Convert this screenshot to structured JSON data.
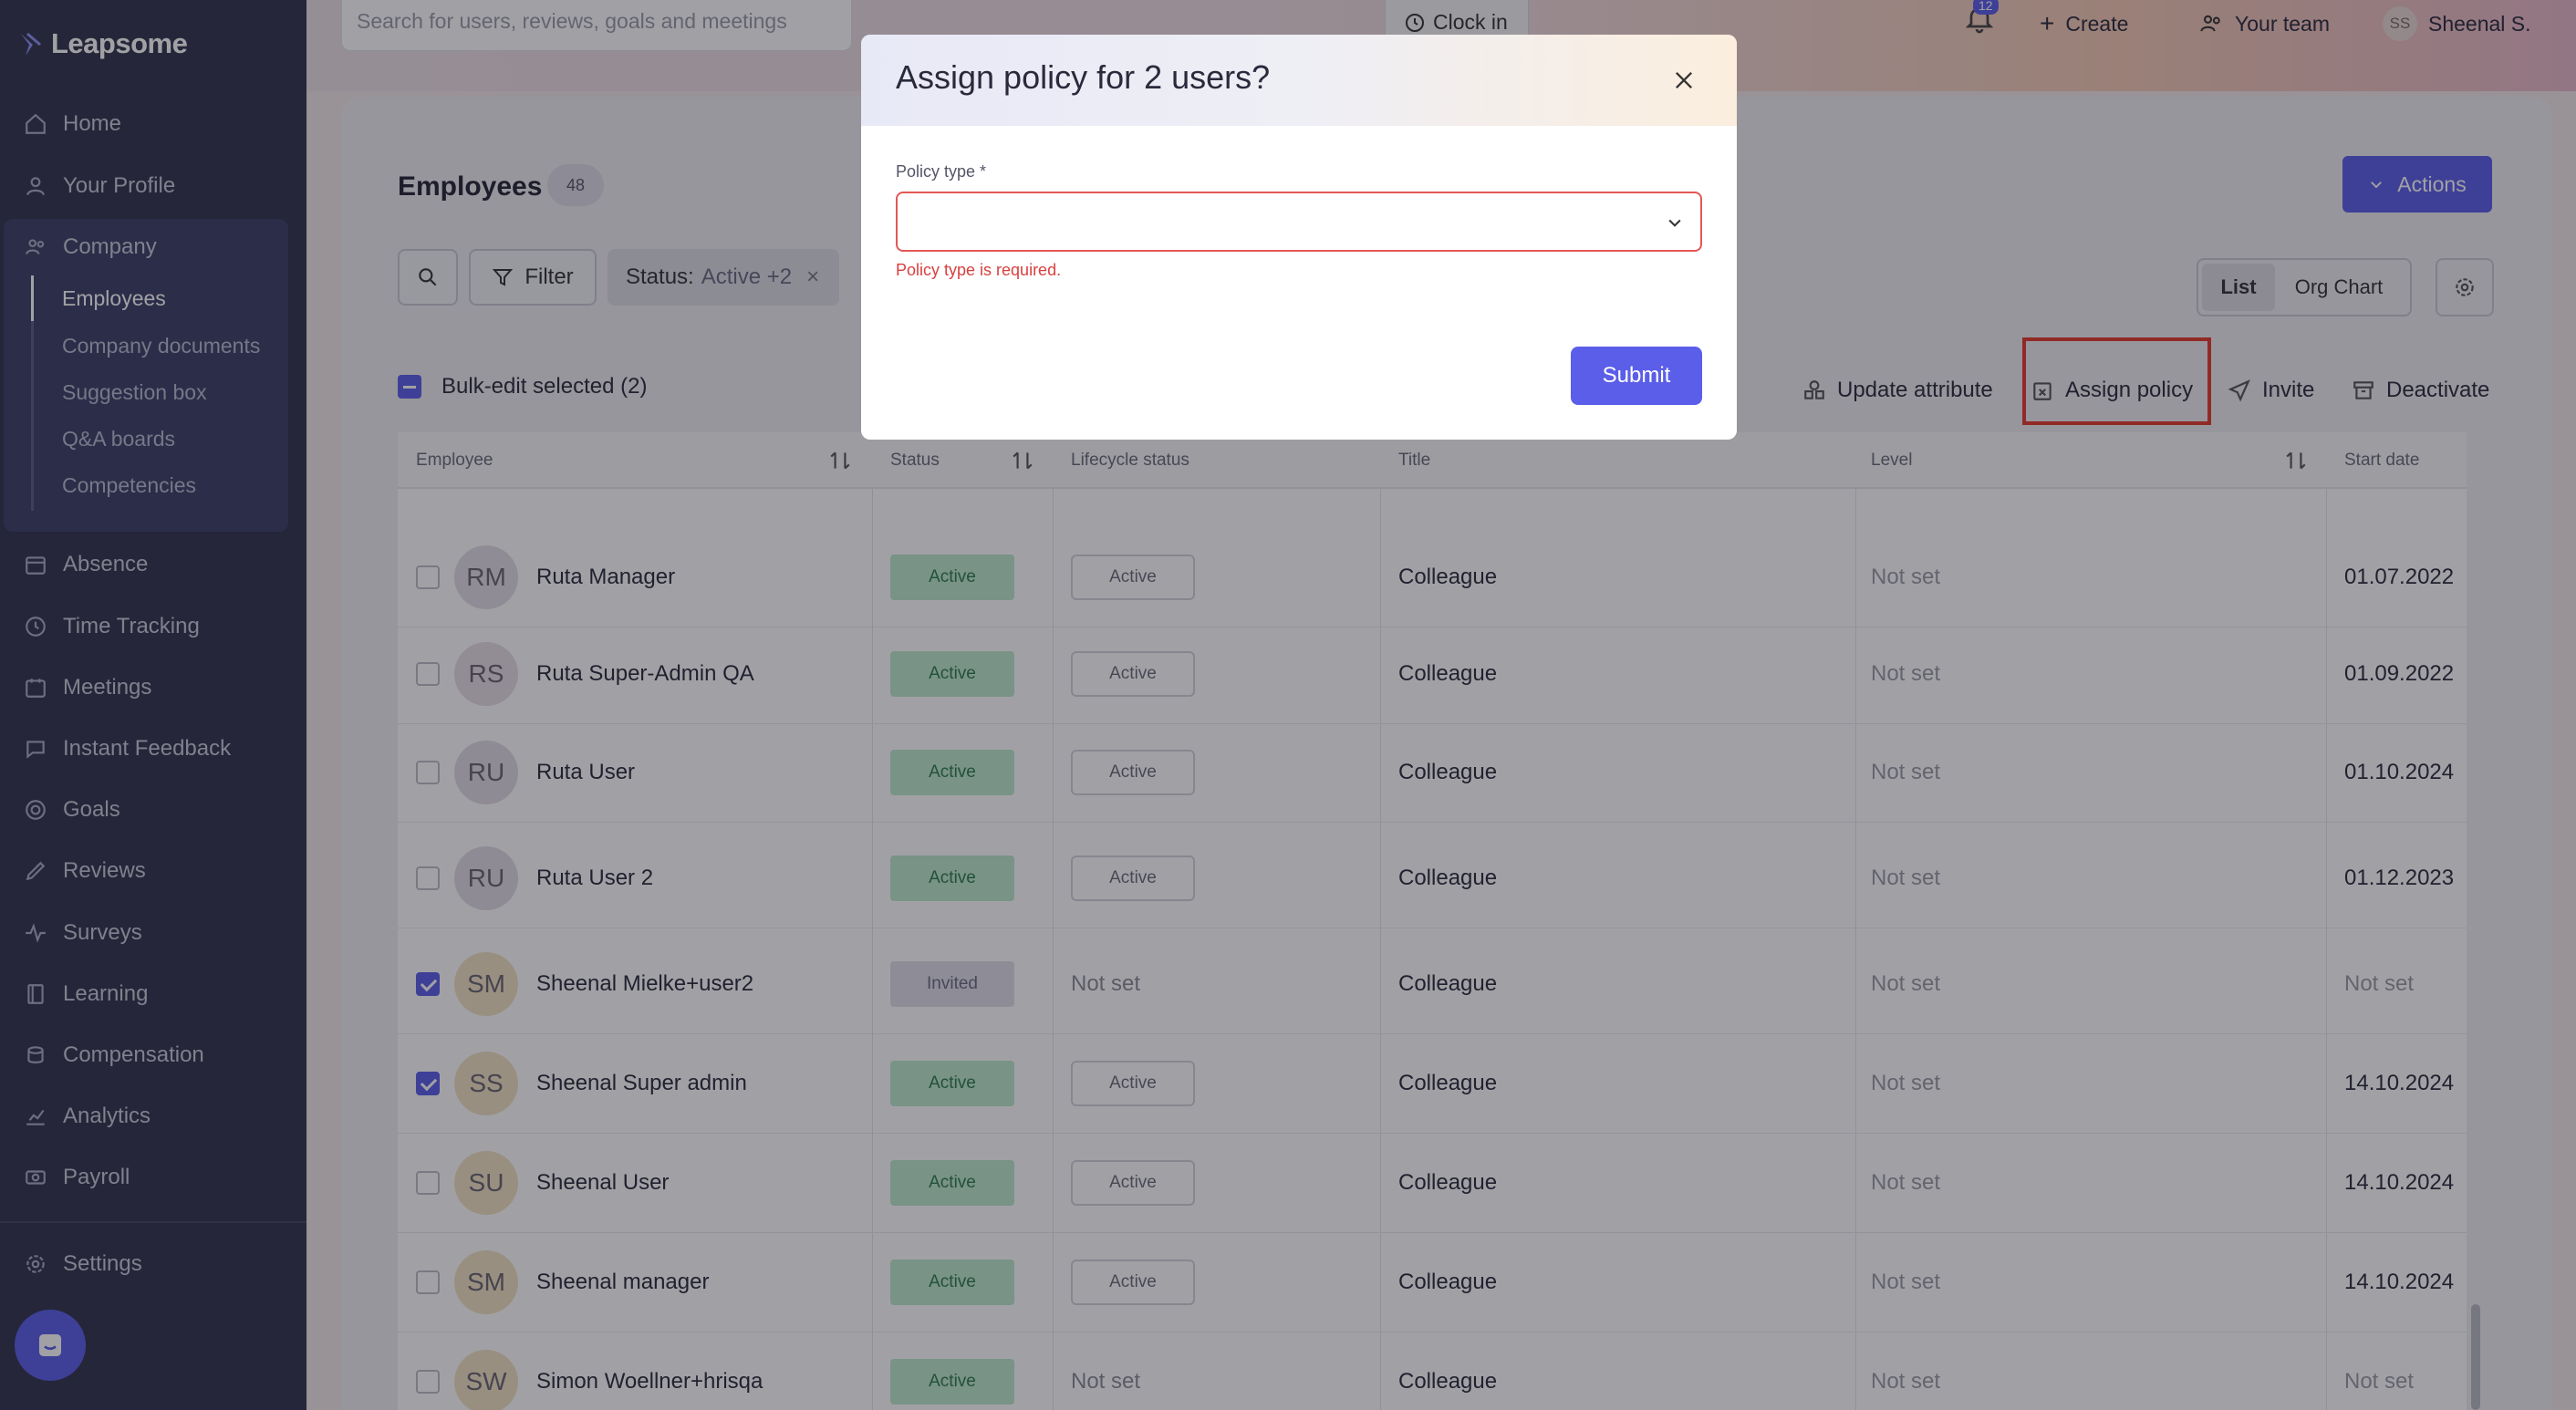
{
  "app": {
    "brand": "Leapsome"
  },
  "search": {
    "placeholder": "Search for users, reviews, goals and meetings"
  },
  "topbar": {
    "clock_in": "Clock in",
    "notif_count": "12",
    "create": "Create",
    "your_team": "Your team",
    "user_initials": "SS",
    "user_name": "Sheenal S."
  },
  "sidebar": {
    "items": [
      {
        "label": "Home",
        "icon": "home-icon"
      },
      {
        "label": "Your Profile",
        "icon": "user-icon"
      },
      {
        "label": "Company",
        "icon": "users-icon"
      },
      {
        "label": "Absence",
        "icon": "calendar-icon"
      },
      {
        "label": "Time Tracking",
        "icon": "clock-icon"
      },
      {
        "label": "Meetings",
        "icon": "calendar-icon"
      },
      {
        "label": "Instant Feedback",
        "icon": "chat-icon"
      },
      {
        "label": "Goals",
        "icon": "target-icon"
      },
      {
        "label": "Reviews",
        "icon": "pen-icon"
      },
      {
        "label": "Surveys",
        "icon": "pulse-icon"
      },
      {
        "label": "Learning",
        "icon": "book-icon"
      },
      {
        "label": "Compensation",
        "icon": "coins-icon"
      },
      {
        "label": "Analytics",
        "icon": "chart-icon"
      },
      {
        "label": "Payroll",
        "icon": "cash-icon"
      },
      {
        "label": "Settings",
        "icon": "gear-icon"
      }
    ],
    "company_sub": [
      "Employees",
      "Company documents",
      "Suggestion box",
      "Q&A boards",
      "Competencies"
    ]
  },
  "page": {
    "title": "Employees",
    "count": "48",
    "actions": "Actions",
    "filter": "Filter",
    "status_label": "Status:",
    "status_value": "Active +2",
    "view_list": "List",
    "view_org": "Org Chart",
    "bulk_label": "Bulk-edit selected (2)",
    "bulk_actions": {
      "update_attribute": "Update attribute",
      "assign_policy": "Assign policy",
      "invite": "Invite",
      "deactivate": "Deactivate"
    }
  },
  "table": {
    "headers": {
      "employee": "Employee",
      "status": "Status",
      "lifecycle": "Lifecycle status",
      "title": "Title",
      "level": "Level",
      "start": "Start date"
    },
    "rows": [
      {
        "initials": "RM",
        "name": "Ruta Manager",
        "status": "Active",
        "lifecycle": "Active",
        "title": "Colleague",
        "level": "Not set",
        "start": "01.07.2022",
        "checked": false,
        "color": "#e3dde4"
      },
      {
        "initials": "RS",
        "name": "Ruta Super-Admin QA",
        "status": "Active",
        "lifecycle": "Active",
        "title": "Colleague",
        "level": "Not set",
        "start": "01.09.2022",
        "checked": false,
        "color": "#e6dde4"
      },
      {
        "initials": "RU",
        "name": "Ruta User",
        "status": "Active",
        "lifecycle": "Active",
        "title": "Colleague",
        "level": "Not set",
        "start": "01.10.2024",
        "checked": false,
        "color": "#e2dbe4"
      },
      {
        "initials": "RU",
        "name": "Ruta User 2",
        "status": "Active",
        "lifecycle": "Active",
        "title": "Colleague",
        "level": "Not set",
        "start": "01.12.2023",
        "checked": false,
        "color": "#e2dbe4"
      },
      {
        "initials": "SM",
        "name": "Sheenal Mielke+user2",
        "status": "Invited",
        "lifecycle": "Not set",
        "title": "Colleague",
        "level": "Not set",
        "start": "Not set",
        "checked": true,
        "color": "#f0e2c4"
      },
      {
        "initials": "SS",
        "name": "Sheenal Super admin",
        "status": "Active",
        "lifecycle": "Active",
        "title": "Colleague",
        "level": "Not set",
        "start": "14.10.2024",
        "checked": true,
        "color": "#f0e2c4"
      },
      {
        "initials": "SU",
        "name": "Sheenal User",
        "status": "Active",
        "lifecycle": "Active",
        "title": "Colleague",
        "level": "Not set",
        "start": "14.10.2024",
        "checked": false,
        "color": "#f0e2c4"
      },
      {
        "initials": "SM",
        "name": "Sheenal manager",
        "status": "Active",
        "lifecycle": "Active",
        "title": "Colleague",
        "level": "Not set",
        "start": "14.10.2024",
        "checked": false,
        "color": "#f0e2c4"
      },
      {
        "initials": "SW",
        "name": "Simon Woellner+hrisqa",
        "status": "Active",
        "lifecycle": "Not set",
        "title": "Colleague",
        "level": "Not set",
        "start": "Not set",
        "checked": false,
        "color": "#f0e2c4"
      }
    ]
  },
  "modal": {
    "title": "Assign policy for 2 users?",
    "field_label": "Policy type *",
    "field_value": "",
    "error": "Policy type is required.",
    "submit": "Submit"
  },
  "colors": {
    "accent": "#5b5ee8",
    "sidebar": "#31324b",
    "error": "#d9403f",
    "highlight": "#e53a2c"
  }
}
